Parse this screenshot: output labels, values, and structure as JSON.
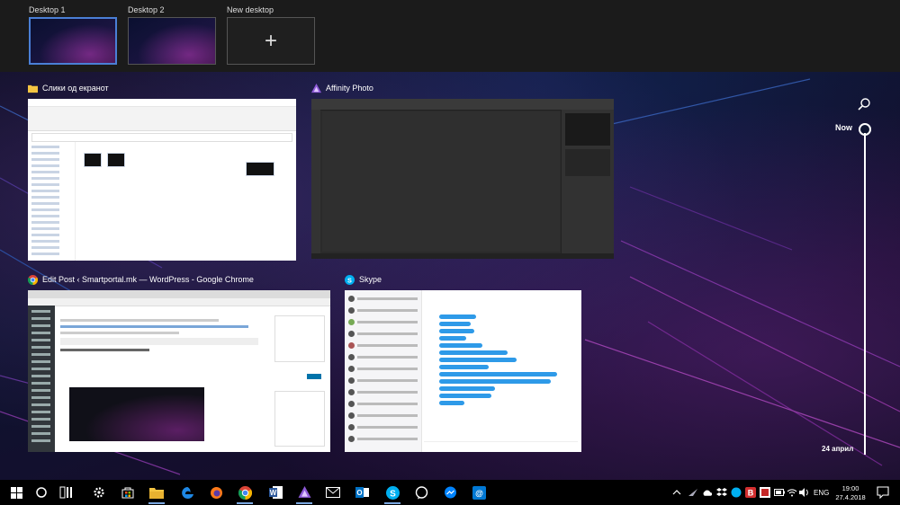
{
  "desktops": {
    "items": [
      {
        "label": "Desktop 1",
        "active": true
      },
      {
        "label": "Desktop 2",
        "active": false
      }
    ],
    "new_label": "New desktop"
  },
  "windows": {
    "explorer": {
      "title": "Слики од екранот",
      "icon": "folder-icon"
    },
    "affinity": {
      "title": "Affinity Photo",
      "icon": "affinity-photo-icon"
    },
    "chrome": {
      "title": "Edit Post ‹ Smartportal.mk — WordPress - Google Chrome",
      "icon": "chrome-icon"
    },
    "skype": {
      "title": "Skype",
      "icon": "skype-icon"
    }
  },
  "timeline": {
    "now_label": "Now",
    "date_label": "24 април"
  },
  "taskbar": {
    "pinned": [
      "start-icon",
      "cortana-icon",
      "task-view-icon",
      "settings-icon",
      "store-icon",
      "file-explorer-icon",
      "edge-icon",
      "firefox-icon",
      "chrome-icon",
      "word-icon",
      "affinity-photo-icon",
      "mail-icon",
      "outlook-icon",
      "skype-icon",
      "viber-icon",
      "messenger-icon",
      "outlook-calendar-icon"
    ],
    "language": "ENG",
    "time": "19:00",
    "date": "27.4.2018"
  },
  "colors": {
    "accent": "#4a7fd6",
    "skype_blue": "#00aff0",
    "affinity_purple": "#7c4dcc",
    "chrome_red": "#db4437"
  }
}
